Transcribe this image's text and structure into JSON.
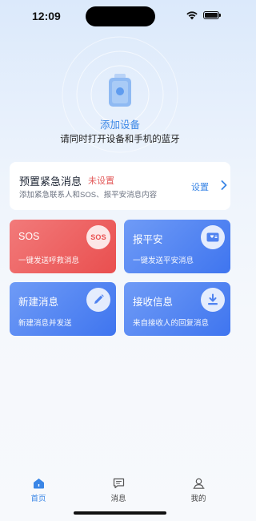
{
  "status_bar": {
    "time": "12:09",
    "icons": [
      "wifi-icon",
      "battery-icon"
    ]
  },
  "hero": {
    "icon": "device-icon",
    "title": "添加设备",
    "subtitle": "请同时打开设备和手机的蓝牙"
  },
  "preset": {
    "title": "预置紧急消息",
    "status": "未设置",
    "description": "添加紧急联系人和SOS、报平安消息内容",
    "action": "设置",
    "icon": "chevron-right-icon"
  },
  "tiles": [
    {
      "title": "SOS",
      "description": "一键发送呼救消息",
      "icon": "sos-icon",
      "icon_text": "SOS",
      "color": "#e94f4f"
    },
    {
      "title": "报平安",
      "description": "一键发送平安消息",
      "icon": "card-icon",
      "color": "#3f75ef"
    },
    {
      "title": "新建消息",
      "description": "新建消息并发送",
      "icon": "pencil-icon",
      "color": "#3f75ef"
    },
    {
      "title": "接收信息",
      "description": "来自接收人的回复消息",
      "icon": "download-icon",
      "color": "#3f75ef"
    }
  ],
  "tabbar": {
    "items": [
      {
        "label": "首页",
        "icon": "home-icon",
        "active": true
      },
      {
        "label": "消息",
        "icon": "message-icon",
        "active": false
      },
      {
        "label": "我的",
        "icon": "profile-icon",
        "active": false
      }
    ]
  },
  "colors": {
    "accent": "#3a86e6",
    "danger": "#e35b5b"
  }
}
